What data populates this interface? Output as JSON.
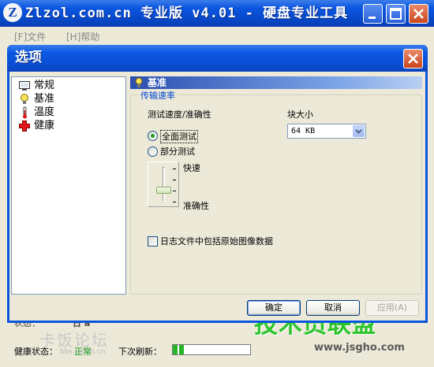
{
  "main_window": {
    "title": "Zlzol.com.cn 专业版 v4.01 - 硬盘专业工具",
    "menu": {
      "file": "[F]文件",
      "help": "[H]帮助"
    },
    "status": {
      "label": "状态：",
      "text": "日 a"
    },
    "health": {
      "label": "健康状态：",
      "value": "正常"
    },
    "refresh": {
      "label": "下次刷新：",
      "progress_fraction": 0.15
    },
    "watermark_left": "卡饭论坛",
    "watermark_left_url": "bbs.kafan.cn",
    "watermark_right": "技术员联盟",
    "watermark_right_url": "www.jsgho.com"
  },
  "dialog": {
    "title": "选项",
    "tree": [
      {
        "label": "常规",
        "icon": "monitor-icon"
      },
      {
        "label": "基准",
        "icon": "lightbulb-icon"
      },
      {
        "label": "温度",
        "icon": "thermometer-icon"
      },
      {
        "label": "健康",
        "icon": "red-cross-icon"
      }
    ],
    "panel": {
      "title": "基准",
      "group_title": "传输速率",
      "speed_label": "测试速度/准确性",
      "radio_full": "全面测试",
      "radio_partial": "部分测试",
      "selected_mode": "全面测试",
      "slider_fast": "快速",
      "slider_accuracy": "准确性",
      "block_size_label": "块大小",
      "block_size_value": "64 KB",
      "log_checkbox_label": "日志文件中包括原始图像数据",
      "log_checkbox_checked": false
    },
    "buttons": {
      "ok": "确定",
      "cancel": "取消",
      "apply": "应用(A)"
    }
  },
  "colors": {
    "titlebar_blue": "#0a55e0",
    "close_red": "#c9431a",
    "ok_green": "#1a9a1a",
    "group_title_blue": "#0046d5"
  }
}
